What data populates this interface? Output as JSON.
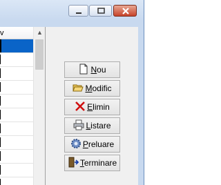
{
  "grid": {
    "header_text": "v",
    "scroll_up_glyph": "▲",
    "row_count": 11,
    "selected_row": 1
  },
  "buttons": [
    {
      "name": "nou-button",
      "accel": "N",
      "rest": "ou",
      "icon": "new-document-icon"
    },
    {
      "name": "modific-button",
      "accel": "M",
      "rest": "odific",
      "icon": "open-folder-icon"
    },
    {
      "name": "elimin-button",
      "accel": "E",
      "rest": "limin",
      "icon": "red-x-icon"
    },
    {
      "name": "listare-button",
      "accel": "L",
      "rest": "istare",
      "icon": "printer-icon"
    },
    {
      "name": "preluare-button",
      "accel": "P",
      "rest": "reluare",
      "icon": "gear-icon"
    },
    {
      "name": "terminare-button",
      "accel": "T",
      "rest": "erminare",
      "icon": "exit-door-icon"
    }
  ]
}
